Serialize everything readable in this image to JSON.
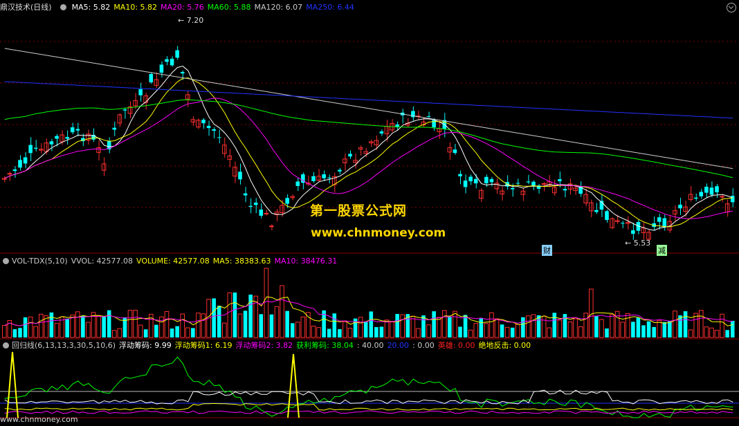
{
  "price_panel": {
    "title": "鼎汉技术(日线)",
    "ma_labels": [
      {
        "text": "MA5: 5.82",
        "color": "#ffffff"
      },
      {
        "text": "MA10: 5.82",
        "color": "#ffff00"
      },
      {
        "text": "MA20: 5.76",
        "color": "#ff00ff"
      },
      {
        "text": "MA60: 5.88",
        "color": "#00ff00"
      },
      {
        "text": "MA120: 6.07",
        "color": "#cccccc"
      },
      {
        "text": "MA250: 6.44",
        "color": "#2233ff"
      }
    ],
    "high_label": "7.20",
    "low_label": "5.53",
    "tag_cai": "财",
    "tag_jian": "减",
    "watermark_cn": "第一股票公式网",
    "watermark_url": "www.chnmoney.com"
  },
  "volume_panel": {
    "labels": [
      {
        "text": "VOL-TDX(5,10)",
        "color": "#cccccc"
      },
      {
        "text": "VVOL: 42577.08",
        "color": "#cccccc"
      },
      {
        "text": "VOLUME: 42577.08",
        "color": "#ffff00"
      },
      {
        "text": "MA5: 38383.63",
        "color": "#ffff00"
      },
      {
        "text": "MA10: 38476.31",
        "color": "#ff00ff"
      }
    ]
  },
  "indicator_panel": {
    "labels": [
      {
        "text": "回归线(6,13,13,3,30,5,10,6)",
        "color": "#cccccc"
      },
      {
        "text": "浮动筹码: 9.99",
        "color": "#ffffff"
      },
      {
        "text": "浮动筹码1: 6.19",
        "color": "#ffff00"
      },
      {
        "text": "浮动筹码2: 3.82",
        "color": "#ff00ff"
      },
      {
        "text": "获利筹码: 38.04",
        "color": "#00ff00"
      },
      {
        "text": ": 40.00",
        "color": "#cccccc"
      },
      {
        "text": "20.00",
        "color": "#2233ff"
      },
      {
        "text": ": 0.00",
        "color": "#cccccc"
      },
      {
        "text": "英雄: 0.00",
        "color": "#ff2222"
      },
      {
        "text": "绝地反击: 0.00",
        "color": "#ffff00"
      }
    ],
    "bottom_watermark": "www.chnmoney.com"
  },
  "colors": {
    "up": "#ff3030",
    "down": "#00ffff",
    "ma5": "#ffffff",
    "ma10": "#ffff00",
    "ma20": "#ff00ff",
    "ma60": "#00ff00",
    "ma120": "#cccccc",
    "ma250": "#2233ff",
    "grid": "#8b0000"
  }
}
